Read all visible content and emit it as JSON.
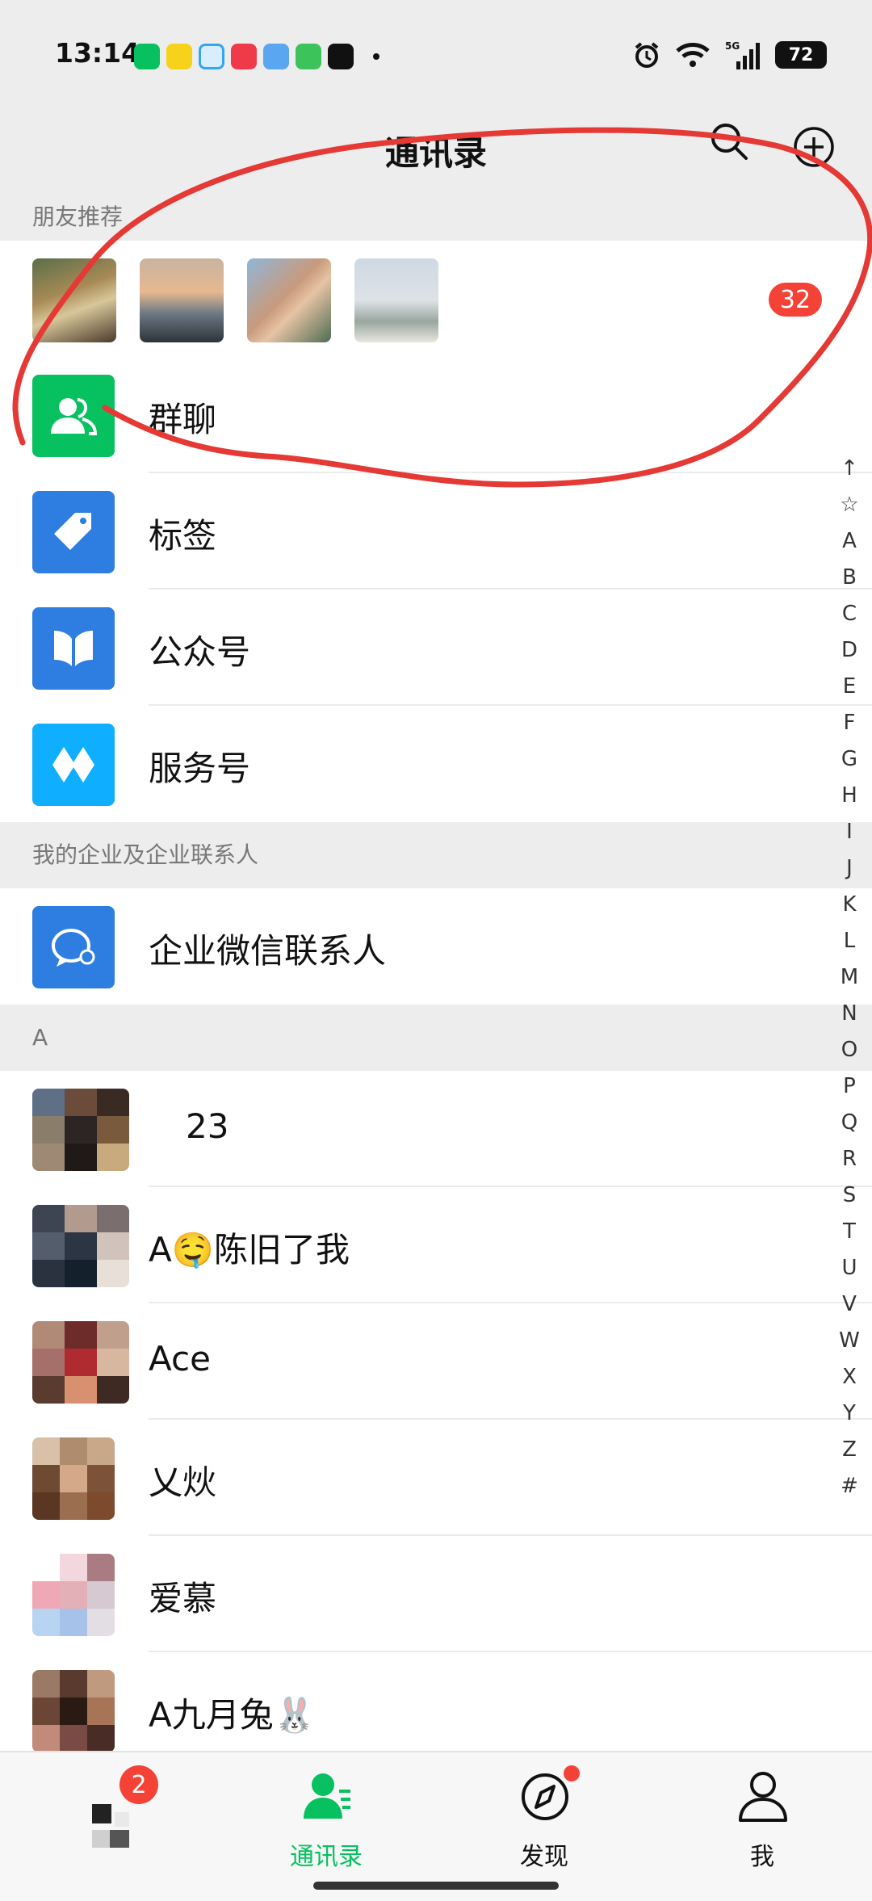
{
  "status_bar": {
    "time": "13:14",
    "battery": "72",
    "signal_label": "5G"
  },
  "header": {
    "title": "通讯录"
  },
  "sections": {
    "friend_recommend": "朋友推荐",
    "enterprise": "我的企业及企业联系人",
    "letter_a": "A"
  },
  "recommendations": {
    "badge_count": "32"
  },
  "menu": {
    "group_chat": "群聊",
    "tags": "标签",
    "official_accounts": "公众号",
    "service_accounts": "服务号",
    "wecom_contacts": "企业微信联系人"
  },
  "contacts": [
    {
      "name": "23"
    },
    {
      "name": "A🤤陈旧了我"
    },
    {
      "name": "Ace"
    },
    {
      "name": "乂炏"
    },
    {
      "name": "爱慕"
    },
    {
      "name": "A九月兔🐰"
    }
  ],
  "alpha_index": [
    "↑",
    "☆",
    "A",
    "B",
    "C",
    "D",
    "E",
    "F",
    "G",
    "H",
    "I",
    "J",
    "K",
    "L",
    "M",
    "N",
    "O",
    "P",
    "Q",
    "R",
    "S",
    "T",
    "U",
    "V",
    "W",
    "X",
    "Y",
    "Z",
    "#"
  ],
  "tabs": {
    "chats_badge": "2",
    "contacts": "通讯录",
    "discover": "发现",
    "me": "我"
  },
  "colors": {
    "wechat_green": "#07c160",
    "tag_blue": "#2e7de0",
    "badge_red": "#f44336",
    "annotation_red": "#e53935"
  }
}
